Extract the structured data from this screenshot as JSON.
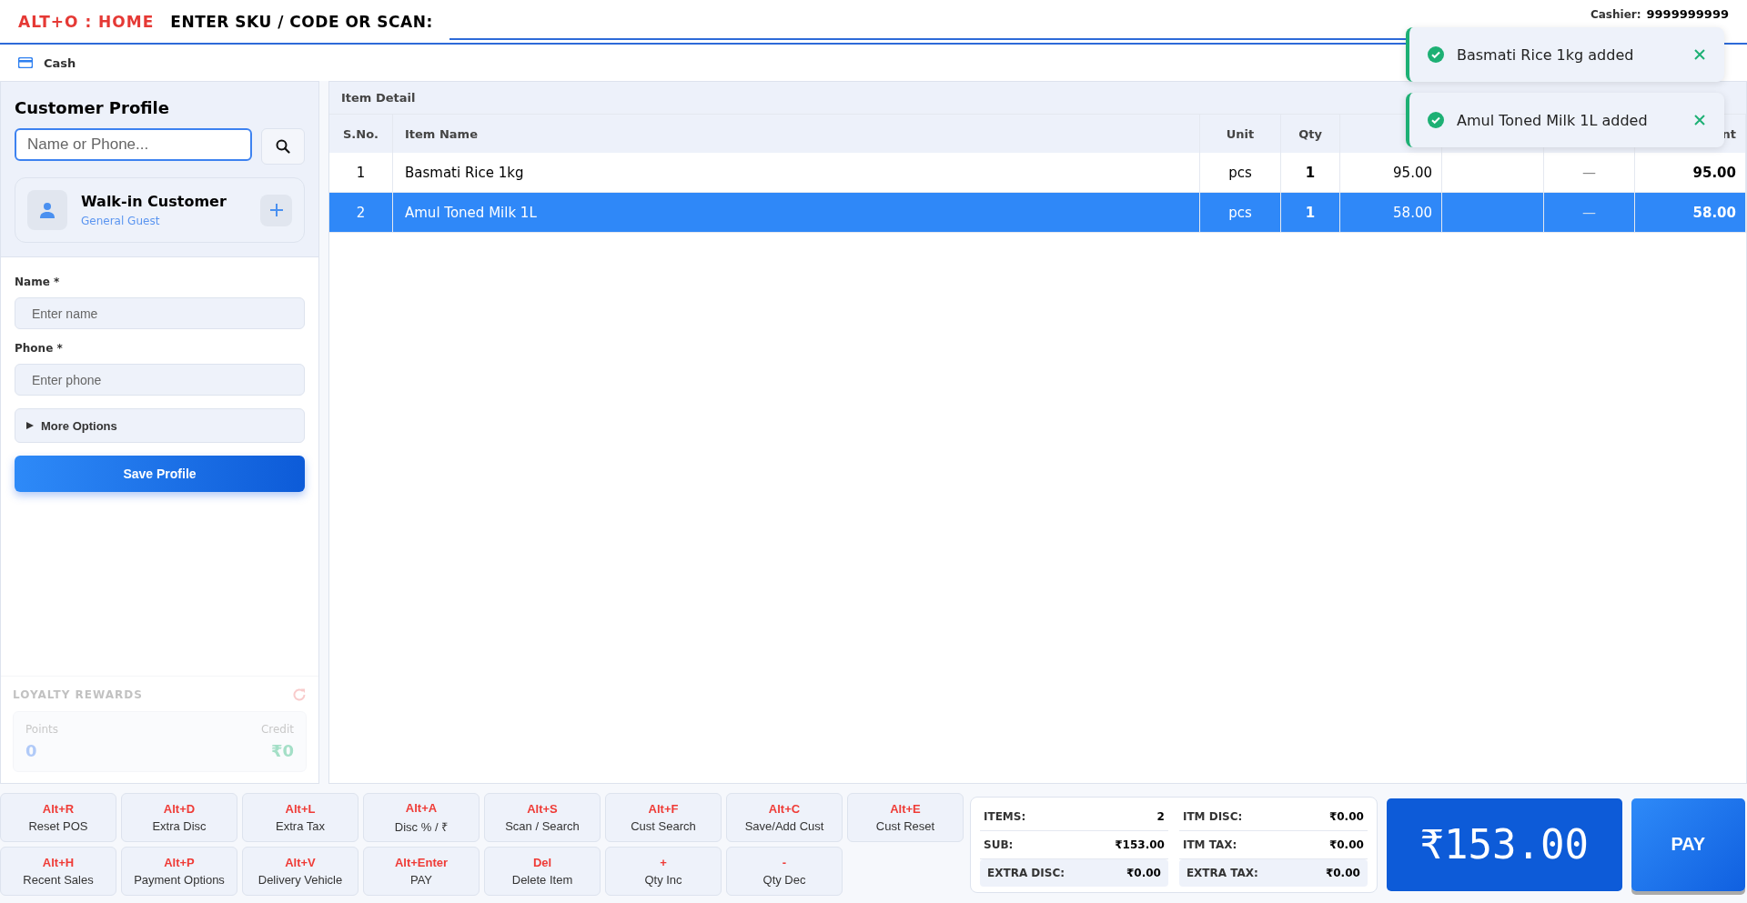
{
  "header": {
    "home_shortcut": "ALT+O : HOME",
    "sku_label": "ENTER SKU / CODE OR SCAN:",
    "cashier_label": "Cashier:",
    "cashier_value": "9999999999"
  },
  "payment_mode": {
    "label": "Cash"
  },
  "customer_profile": {
    "title": "Customer Profile",
    "search_placeholder": "Name or Phone...",
    "customer_name": "Walk-in Customer",
    "customer_type": "General Guest",
    "fields": [
      {
        "label": "Name *",
        "placeholder": "Enter name"
      },
      {
        "label": "Phone *",
        "placeholder": "Enter phone"
      }
    ],
    "more_options": {
      "label": "More Options",
      "expanded": false
    },
    "save_button": "Save Profile"
  },
  "loyalty": {
    "title": "LOYALTY REWARDS",
    "disabled": true,
    "points_label": "Points",
    "points_value": "0",
    "credit_label": "Credit",
    "credit_value": "₹0"
  },
  "item_detail": {
    "title": "Item Detail",
    "columns": [
      "S.No.",
      "Item Name",
      "Unit",
      "Qty",
      "",
      "",
      "",
      "nt"
    ],
    "rows": [
      {
        "cells": [
          "1",
          "Basmati Rice 1kg",
          "pcs",
          "1",
          "95.00",
          "",
          "—",
          "95.00"
        ],
        "selected": false
      },
      {
        "cells": [
          "2",
          "Amul Toned Milk 1L",
          "pcs",
          "1",
          "58.00",
          "",
          "—",
          "58.00"
        ],
        "selected": true
      }
    ]
  },
  "toasts": [
    {
      "message": "Basmati Rice 1kg added"
    },
    {
      "message": "Amul Toned Milk 1L added"
    }
  ],
  "shortcuts": [
    {
      "key": "Alt+R",
      "label": "Reset POS"
    },
    {
      "key": "Alt+D",
      "label": "Extra Disc"
    },
    {
      "key": "Alt+L",
      "label": "Extra Tax"
    },
    {
      "key": "Alt+A",
      "label": "Disc % / ₹"
    },
    {
      "key": "Alt+S",
      "label": "Scan / Search"
    },
    {
      "key": "Alt+F",
      "label": "Cust Search"
    },
    {
      "key": "Alt+C",
      "label": "Save/Add Cust"
    },
    {
      "key": "Alt+E",
      "label": "Cust Reset"
    },
    {
      "key": "Alt+H",
      "label": "Recent Sales"
    },
    {
      "key": "Alt+P",
      "label": "Payment Options"
    },
    {
      "key": "Alt+V",
      "label": "Delivery Vehicle"
    },
    {
      "key": "Alt+Enter",
      "label": "PAY"
    },
    {
      "key": "Del",
      "label": "Delete Item"
    },
    {
      "key": "+",
      "label": "Qty Inc"
    },
    {
      "key": "-",
      "label": "Qty Dec"
    }
  ],
  "summary": [
    {
      "label": "ITEMS:",
      "value": "2",
      "kind": "plain"
    },
    {
      "label": "ITM DISC:",
      "value": "₹0.00",
      "kind": "plain"
    },
    {
      "label": "SUB:",
      "value": "₹153.00",
      "kind": "plain"
    },
    {
      "label": "ITM TAX:",
      "value": "₹0.00",
      "kind": "plain"
    },
    {
      "label": "EXTRA DISC:",
      "value": "₹0.00",
      "kind": "shaded"
    },
    {
      "label": "EXTRA TAX:",
      "value": "₹0.00",
      "kind": "shaded"
    }
  ],
  "total": "₹153.00",
  "pay_button": "PAY"
}
